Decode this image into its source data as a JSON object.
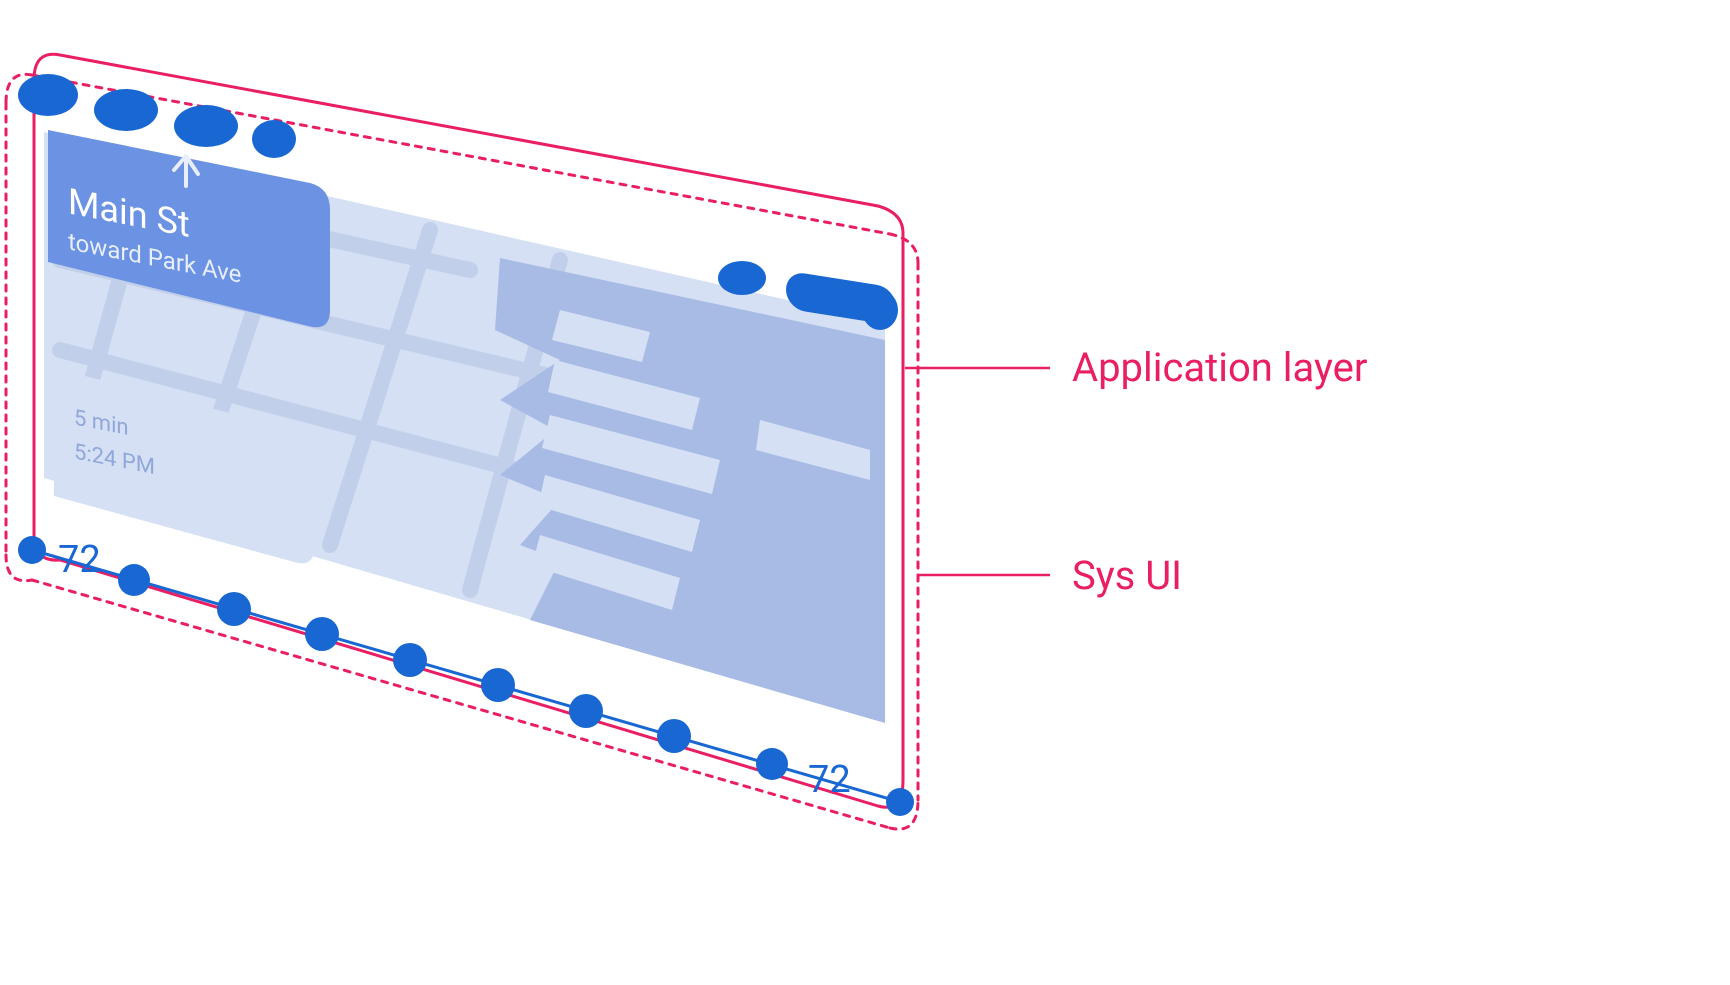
{
  "annotations": {
    "application_layer": "Application layer",
    "sys_ui": "Sys UI"
  },
  "navigation_card": {
    "street": "Main St",
    "direction": "toward Park Ave"
  },
  "eta_card": {
    "duration": "5 min",
    "arrival": "5:24 PM"
  },
  "inset_spec": {
    "left_label": "72",
    "right_label": "72"
  },
  "colors": {
    "pink": "#E91E63",
    "blue_primary": "#1967D2",
    "blue_mid": "#6B92E3",
    "blue_light": "#D6E0F4",
    "blue_road": "#C1CFEA",
    "blue_shadow": "#A7BBE5",
    "white": "#FFFFFF",
    "text_on_blue": "#E8EEFB",
    "eta_text": "#8FA7DA"
  }
}
